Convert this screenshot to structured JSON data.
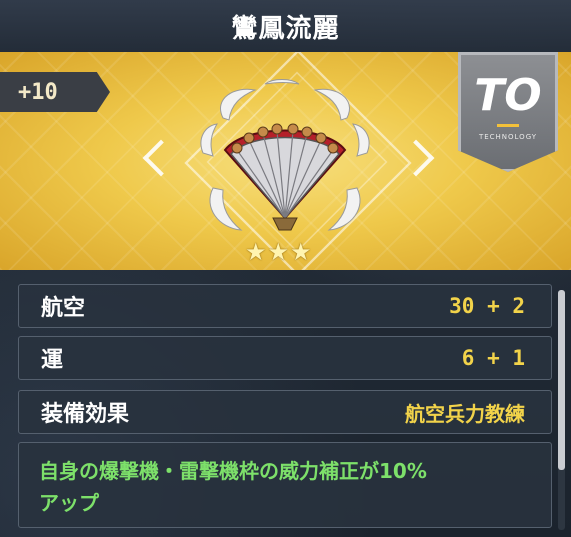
{
  "equipment": {
    "name": "鸞鳳流麗",
    "enhancement": "+10",
    "category_badge": {
      "letters": "TO",
      "caption": "TECHNOLOGY",
      "icon": "technology-badge-icon"
    },
    "item_icon": "folding-fan-icon",
    "rarity_stars": 3,
    "star_glyph": "★"
  },
  "stats": [
    {
      "label": "航空",
      "value": "30 + 2"
    },
    {
      "label": "運",
      "value": "6 + 1"
    }
  ],
  "equipment_effect": {
    "label": "装備効果",
    "value": "航空兵力教練"
  },
  "description": {
    "line1": "自身の爆撃機・雷撃機枠の威力補正が10%",
    "line2": "アップ"
  },
  "colors": {
    "banner_gold": "#efc94b",
    "stat_value": "#f2d34a",
    "description_text": "#7de06a",
    "panel_bg": "#28323e"
  }
}
